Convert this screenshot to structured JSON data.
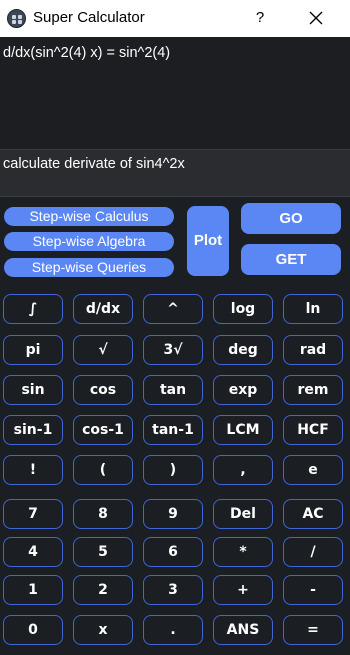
{
  "window": {
    "title": "Super Calculator",
    "help_label": "?"
  },
  "output": {
    "text": "d/dx(sin^2(4) x) = sin^2(4)"
  },
  "input": {
    "value": "calculate derivate of sin4^2x"
  },
  "modes": [
    {
      "label": "Step-wise Calculus"
    },
    {
      "label": "Step-wise Algebra"
    },
    {
      "label": "Step-wise Queries"
    }
  ],
  "actions": {
    "plot": "Plot",
    "go": "GO",
    "get": "GET"
  },
  "keys": [
    [
      "∫",
      "d/dx",
      "^",
      "log",
      "ln"
    ],
    [
      "pi",
      "√",
      "3√",
      "deg",
      "rad"
    ],
    [
      "sin",
      "cos",
      "tan",
      "exp",
      "rem"
    ],
    [
      "sin-1",
      "cos-1",
      "tan-1",
      "LCM",
      "HCF"
    ],
    [
      "!",
      "(",
      ")",
      ",",
      "e"
    ],
    [
      "7",
      "8",
      "9",
      "Del",
      "AC"
    ],
    [
      "4",
      "5",
      "6",
      "*",
      "/"
    ],
    [
      "1",
      "2",
      "3",
      "+",
      "-"
    ],
    [
      "0",
      "x",
      ".",
      "ANS",
      "="
    ]
  ],
  "colors": {
    "accent": "#5b87f5",
    "key_border": "#3f67d6",
    "background": "#1b1e22"
  }
}
